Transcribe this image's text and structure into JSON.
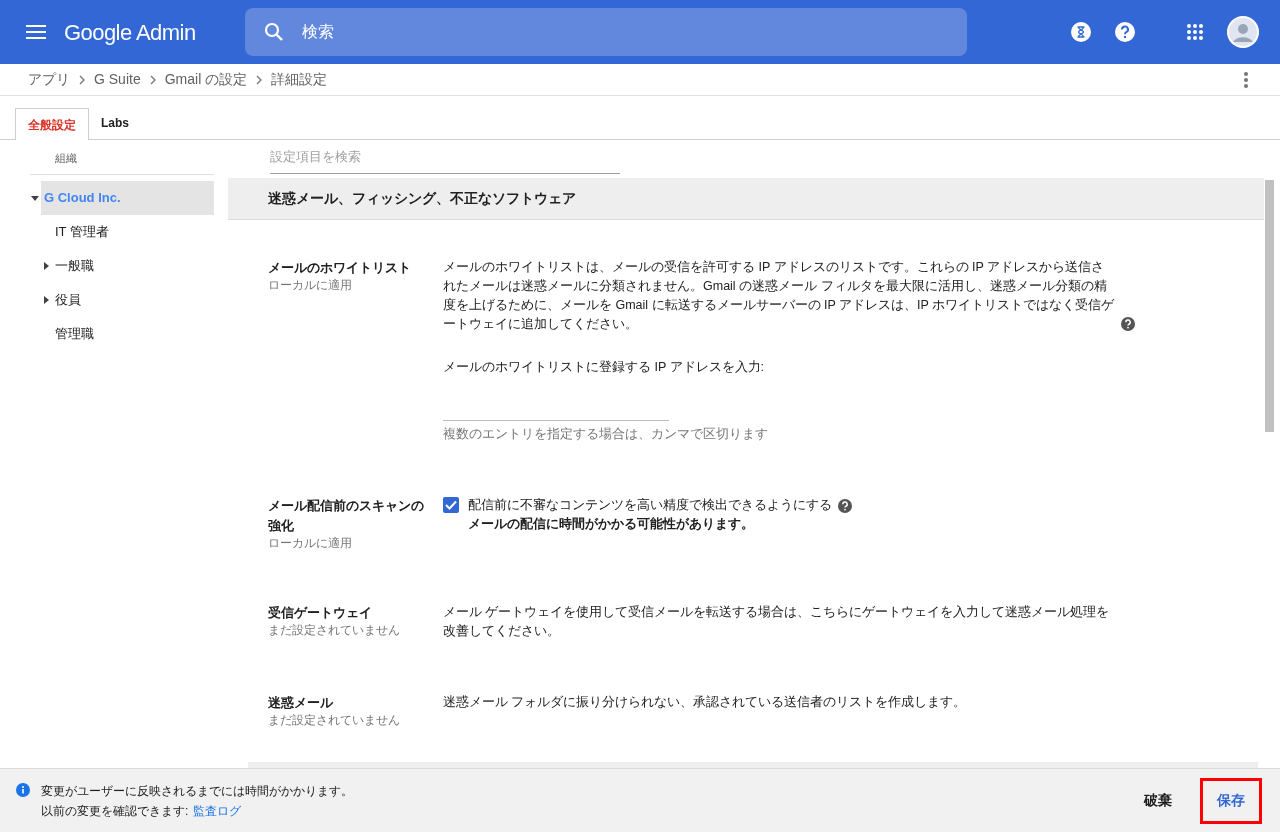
{
  "header": {
    "title": "Google Admin",
    "search_placeholder": "検索"
  },
  "breadcrumb": [
    "アプリ",
    "G Suite",
    "Gmail の設定",
    "詳細設定"
  ],
  "tabs": [
    {
      "label": "全般設定",
      "selected": true
    },
    {
      "label": "Labs",
      "selected": false
    }
  ],
  "sidebar": {
    "heading": "組織",
    "tree": [
      {
        "kind": "group",
        "label": "G Cloud Inc.",
        "selected": true,
        "expanded": true,
        "children": [
          {
            "kind": "leaf",
            "label": "IT 管理者",
            "selected": false
          },
          {
            "kind": "group",
            "label": "一般職",
            "selected": false,
            "expanded": false
          },
          {
            "kind": "group",
            "label": "役員",
            "selected": false,
            "expanded": false
          },
          {
            "kind": "leaf",
            "label": "管理職",
            "selected": false
          }
        ]
      }
    ]
  },
  "settings_search": {
    "placeholder": "設定項目を検索"
  },
  "section": {
    "title": "迷惑メール、フィッシング、不正なソフトウェア",
    "settings": [
      {
        "kind": "whitelist",
        "title": "メールのホワイトリスト",
        "scope": "ローカルに適用",
        "description": "メールのホワイトリストは、メールの受信を許可する IP アドレスのリストです。これらの IP アドレスから送信されたメールは迷惑メールに分類されません。Gmail の迷惑メール フィルタを最大限に活用し、迷惑メール分類の精度を上げるために、メールを Gmail に転送するメールサーバーの IP アドレスは、IP ホワイトリストではなく受信ゲートウェイに追加してください。",
        "input_label": "メールのホワイトリストに登録する IP アドレスを入力:",
        "input_hint": "複数のエントリを指定する場合は、カンマで区切ります"
      },
      {
        "kind": "checkbox",
        "title": "メール配信前のスキャンの強化",
        "scope": "ローカルに適用",
        "checkbox_label": "配信前に不審なコンテンツを高い精度で検出できるようにする",
        "checked": true,
        "note": "メールの配信に時間がかかる可能性があります。"
      },
      {
        "kind": "text",
        "title": "受信ゲートウェイ",
        "scope": "まだ設定されていません",
        "description": "メール ゲートウェイを使用して受信メールを転送する場合は、こちらにゲートウェイを入力して迷惑メール処理を改善してください。"
      },
      {
        "kind": "text",
        "title": "迷惑メール",
        "scope": "まだ設定されていません",
        "description": "迷惑メール フォルダに振り分けられない、承認されている送信者のリストを作成します。"
      }
    ]
  },
  "footer": {
    "message": "変更がユーザーに反映されるまでには時間がかかります。",
    "audit_prefix": "以前の変更を確認できます:",
    "audit_link": "監査ログ",
    "buttons": [
      {
        "kind": "discard",
        "label": "破棄"
      },
      {
        "kind": "save",
        "label": "保存"
      }
    ]
  }
}
